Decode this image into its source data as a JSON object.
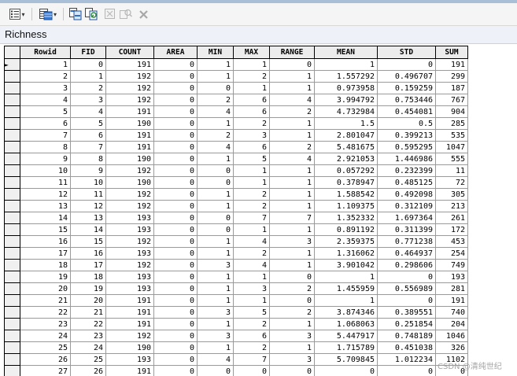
{
  "window": {
    "title": "Richness"
  },
  "toolbar": {
    "buttons": [
      {
        "name": "table-options-icon",
        "has_menu": true
      },
      {
        "name": "select-by-attributes-icon",
        "has_menu": true
      },
      {
        "name": "switch-selection-icon",
        "has_menu": false
      },
      {
        "name": "related-tables-icon",
        "has_menu": false
      },
      {
        "name": "clear-selection-icon",
        "has_menu": false,
        "disabled": true
      },
      {
        "name": "zoom-to-selected-icon",
        "has_menu": false,
        "disabled": true
      },
      {
        "name": "delete-selected-icon",
        "has_menu": false,
        "disabled": true
      }
    ]
  },
  "table": {
    "columns": [
      "Rowid",
      "FID",
      "COUNT",
      "AREA",
      "MIN",
      "MAX",
      "RANGE",
      "MEAN",
      "STD",
      "SUM"
    ],
    "active_row_marker": "►",
    "rows": [
      [
        "1",
        "0",
        "191",
        "0",
        "1",
        "1",
        "0",
        "1",
        "0",
        "191"
      ],
      [
        "2",
        "1",
        "192",
        "0",
        "1",
        "2",
        "1",
        "1.557292",
        "0.496707",
        "299"
      ],
      [
        "3",
        "2",
        "192",
        "0",
        "0",
        "1",
        "1",
        "0.973958",
        "0.159259",
        "187"
      ],
      [
        "4",
        "3",
        "192",
        "0",
        "2",
        "6",
        "4",
        "3.994792",
        "0.753446",
        "767"
      ],
      [
        "5",
        "4",
        "191",
        "0",
        "4",
        "6",
        "2",
        "4.732984",
        "0.454081",
        "904"
      ],
      [
        "6",
        "5",
        "190",
        "0",
        "1",
        "2",
        "1",
        "1.5",
        "0.5",
        "285"
      ],
      [
        "7",
        "6",
        "191",
        "0",
        "2",
        "3",
        "1",
        "2.801047",
        "0.399213",
        "535"
      ],
      [
        "8",
        "7",
        "191",
        "0",
        "4",
        "6",
        "2",
        "5.481675",
        "0.595295",
        "1047"
      ],
      [
        "9",
        "8",
        "190",
        "0",
        "1",
        "5",
        "4",
        "2.921053",
        "1.446986",
        "555"
      ],
      [
        "10",
        "9",
        "192",
        "0",
        "0",
        "1",
        "1",
        "0.057292",
        "0.232399",
        "11"
      ],
      [
        "11",
        "10",
        "190",
        "0",
        "0",
        "1",
        "1",
        "0.378947",
        "0.485125",
        "72"
      ],
      [
        "12",
        "11",
        "192",
        "0",
        "1",
        "2",
        "1",
        "1.588542",
        "0.492098",
        "305"
      ],
      [
        "13",
        "12",
        "192",
        "0",
        "1",
        "2",
        "1",
        "1.109375",
        "0.312109",
        "213"
      ],
      [
        "14",
        "13",
        "193",
        "0",
        "0",
        "7",
        "7",
        "1.352332",
        "1.697364",
        "261"
      ],
      [
        "15",
        "14",
        "193",
        "0",
        "0",
        "1",
        "1",
        "0.891192",
        "0.311399",
        "172"
      ],
      [
        "16",
        "15",
        "192",
        "0",
        "1",
        "4",
        "3",
        "2.359375",
        "0.771238",
        "453"
      ],
      [
        "17",
        "16",
        "193",
        "0",
        "1",
        "2",
        "1",
        "1.316062",
        "0.464937",
        "254"
      ],
      [
        "18",
        "17",
        "192",
        "0",
        "3",
        "4",
        "1",
        "3.901042",
        "0.298606",
        "749"
      ],
      [
        "19",
        "18",
        "193",
        "0",
        "1",
        "1",
        "0",
        "1",
        "0",
        "193"
      ],
      [
        "20",
        "19",
        "193",
        "0",
        "1",
        "3",
        "2",
        "1.455959",
        "0.556989",
        "281"
      ],
      [
        "21",
        "20",
        "191",
        "0",
        "1",
        "1",
        "0",
        "1",
        "0",
        "191"
      ],
      [
        "22",
        "21",
        "191",
        "0",
        "3",
        "5",
        "2",
        "3.874346",
        "0.389551",
        "740"
      ],
      [
        "23",
        "22",
        "191",
        "0",
        "1",
        "2",
        "1",
        "1.068063",
        "0.251854",
        "204"
      ],
      [
        "24",
        "23",
        "192",
        "0",
        "3",
        "6",
        "3",
        "5.447917",
        "0.748189",
        "1046"
      ],
      [
        "25",
        "24",
        "190",
        "0",
        "1",
        "2",
        "1",
        "1.715789",
        "0.451038",
        "326"
      ],
      [
        "26",
        "25",
        "193",
        "0",
        "4",
        "7",
        "3",
        "5.709845",
        "1.012234",
        "1102"
      ],
      [
        "27",
        "26",
        "191",
        "0",
        "0",
        "0",
        "0",
        "0",
        "0",
        "0"
      ]
    ]
  },
  "watermark": "CSDN @清纯世纪"
}
